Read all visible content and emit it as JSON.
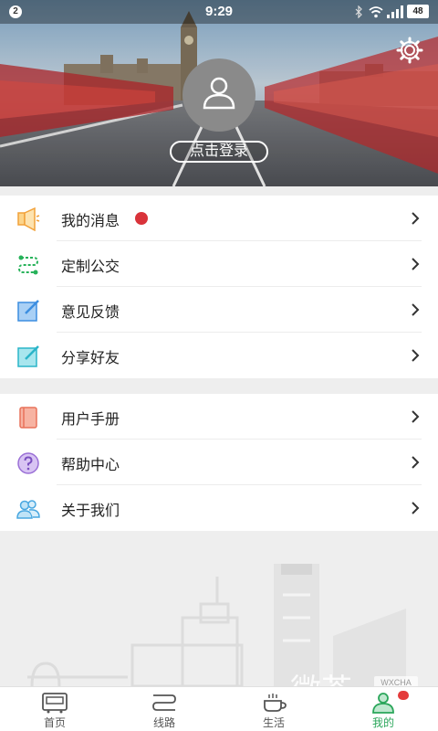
{
  "status_bar": {
    "notification_count": "2",
    "time": "9:29",
    "battery": "48"
  },
  "header": {
    "login_label": "点击登录",
    "settings_icon": "gear-icon",
    "avatar_icon": "user-icon"
  },
  "menu_group_1": [
    {
      "label": "我的消息",
      "icon": "speaker-icon",
      "icon_color": "#f2a23a",
      "has_dot": true
    },
    {
      "label": "定制公交",
      "icon": "route-icon",
      "icon_color": "#27b25a",
      "has_dot": false
    },
    {
      "label": "意见反馈",
      "icon": "feedback-icon",
      "icon_color": "#3c8ee0",
      "has_dot": false
    },
    {
      "label": "分享好友",
      "icon": "share-icon",
      "icon_color": "#2bb5c9",
      "has_dot": false
    }
  ],
  "menu_group_2": [
    {
      "label": "用户手册",
      "icon": "manual-icon",
      "icon_color": "#e8725a"
    },
    {
      "label": "帮助中心",
      "icon": "help-icon",
      "icon_color": "#9a6fd6"
    },
    {
      "label": "关于我们",
      "icon": "users-icon",
      "icon_color": "#49a7e0"
    }
  ],
  "watermark": {
    "text": "微茶",
    "tag": "WXCHA"
  },
  "tabbar": [
    {
      "label": "首页",
      "icon": "bus-icon",
      "active": false
    },
    {
      "label": "线路",
      "icon": "route-line-icon",
      "active": false
    },
    {
      "label": "生活",
      "icon": "coffee-icon",
      "active": false
    },
    {
      "label": "我的",
      "icon": "profile-icon",
      "active": true
    }
  ],
  "colors": {
    "accent": "#2aa65a",
    "badge": "#e43b3b"
  }
}
